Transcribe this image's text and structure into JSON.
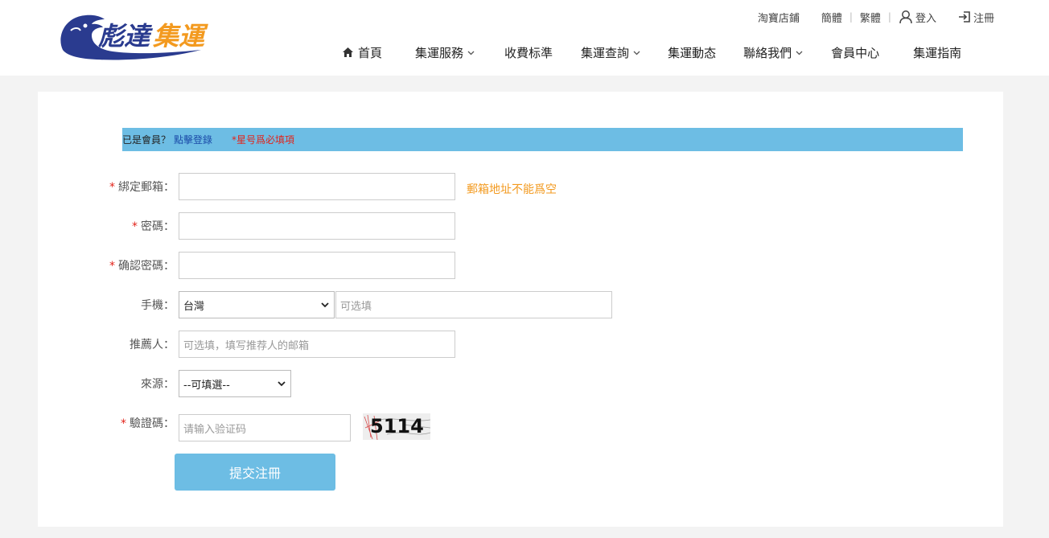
{
  "brand": {
    "logo_text": "彪達集運",
    "logo_text_main": "彪達",
    "logo_text_accent": "集運",
    "primary_color": "#2a3b8f",
    "accent_color": "#f39a1f"
  },
  "topbar": {
    "taobao": "淘寶店鋪",
    "simplified": "簡體",
    "traditional": "繁體",
    "login": "登入",
    "register": "注冊"
  },
  "nav": {
    "home": "首頁",
    "services": "集運服務",
    "fees": "收費标準",
    "query": "集運查詢",
    "news": "集運動态",
    "contact": "聯絡我們",
    "member": "會員中心",
    "guide": "集運指南"
  },
  "notice": {
    "already_member": "已是會員？",
    "login_link": "點擊登錄",
    "required_note": "*星号爲必填項"
  },
  "form": {
    "email": {
      "label": "綁定郵箱：",
      "value": "",
      "error": "郵箱地址不能爲空"
    },
    "password": {
      "label": "密碼：",
      "value": ""
    },
    "confirm_password": {
      "label": "确認密碼：",
      "value": ""
    },
    "phone": {
      "label": "手機：",
      "region_selected": "台灣",
      "placeholder": "可选填"
    },
    "referrer": {
      "label": "推薦人：",
      "placeholder": "可选填，填写推荐人的邮箱"
    },
    "source": {
      "label": "來源：",
      "selected": "--可填選--"
    },
    "captcha": {
      "label": "驗證碼：",
      "placeholder": "请输入验证码",
      "image_text": "5114"
    },
    "submit_label": "提交注冊"
  },
  "colors": {
    "notice_bg": "#6dbde4",
    "required": "#e2231a",
    "error_text": "#f39a1f",
    "submit_bg": "#6dbde4"
  }
}
